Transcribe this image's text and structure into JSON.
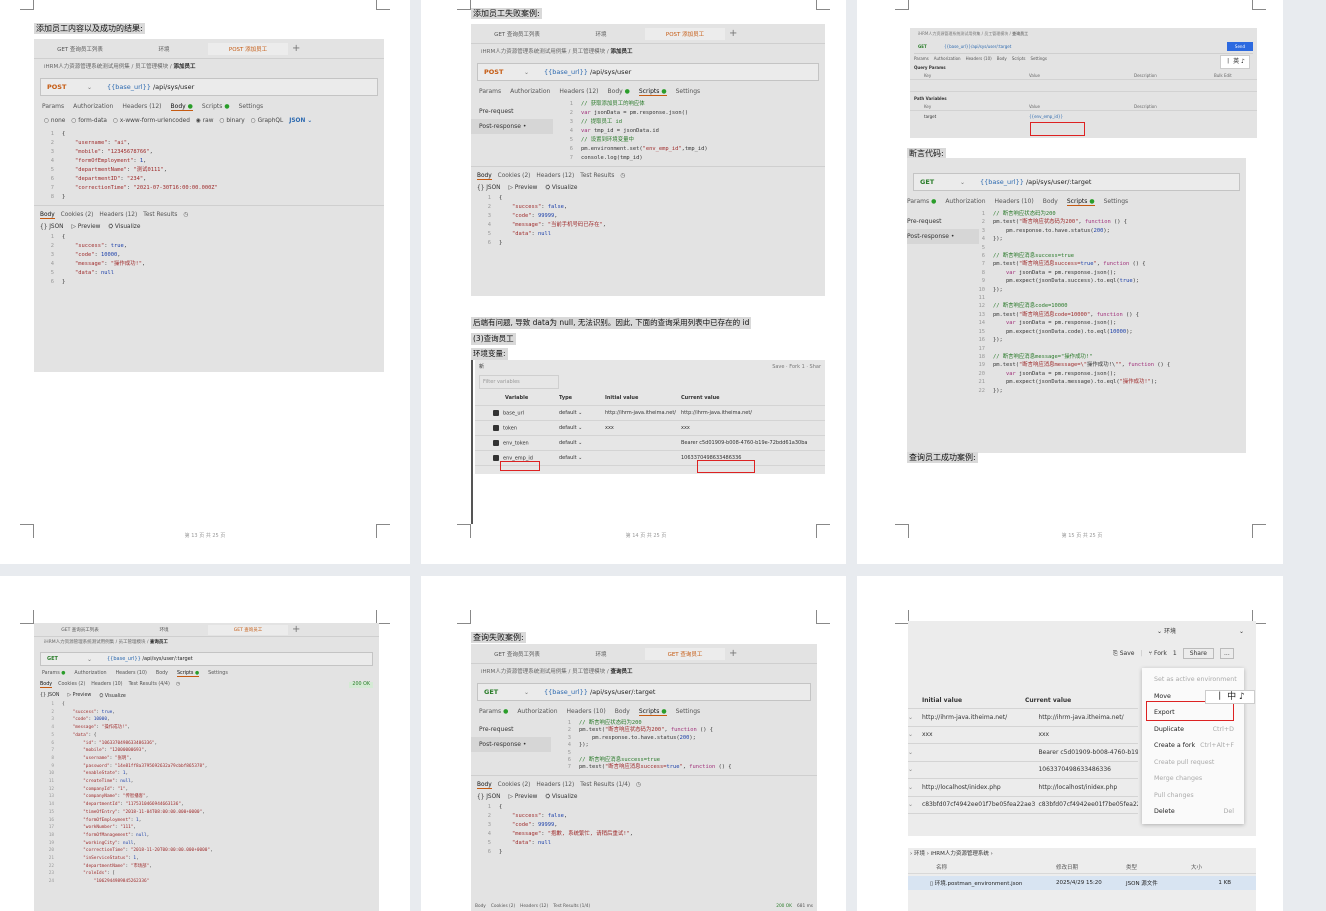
{
  "page_numbers": [
    "第 13 页 共 25 页",
    "第 14 页 共 25 页",
    "第 15 页 共 25 页"
  ],
  "p13": {
    "caption": "添加员工内容以及成功的结果:",
    "tabs": [
      "GET 查询员工列表",
      "环境",
      "POST 添加员工"
    ],
    "crumb": "iHRM人力资源管理系统测试用例集 / 员工管理模块 /",
    "crumb_bold": "添加员工",
    "method": "POST",
    "url_var": "{{base_url}}",
    "url_path": " /api/sys/user",
    "subtabs": [
      "Params",
      "Authorization",
      "Headers (12)",
      "Body",
      "Scripts",
      "Settings"
    ],
    "radios": [
      "none",
      "form-data",
      "x-www-form-urlencoded",
      "raw",
      "binary",
      "GraphQL",
      "JSON"
    ],
    "body_lines": [
      "{",
      "    \"username\": \"ai\",",
      "    \"mobile\": \"12345678766\",",
      "    \"formOfEmployment\": 1,",
      "    \"departmentName\": \"测试0111\",",
      "    \"departmentID\": \"234\",",
      "    \"correctionTime\": \"2021-07-30T16:00:00.000Z\"",
      "}"
    ],
    "resp_tabs": [
      "Body",
      "Cookies (2)",
      "Headers (12)",
      "Test Results"
    ],
    "json_bar": [
      "{} JSON",
      "Preview",
      "Visualize"
    ],
    "resp_lines": [
      "{",
      "    \"success\": true,",
      "    \"code\": 10000,",
      "    \"message\": \"操作成功!\",",
      "    \"data\": null",
      "}"
    ]
  },
  "p14": {
    "caption": "添加员工失败案例:",
    "tabs": [
      "GET 查询员工列表",
      "环境",
      "POST 添加员工"
    ],
    "crumb": "iHRM人力资源管理系统测试用例集 / 员工管理模块 /",
    "crumb_bold": "添加员工",
    "method": "POST",
    "url_var": "{{base_url}}",
    "url_path": " /api/sys/user",
    "subtabs": [
      "Params",
      "Authorization",
      "Headers (12)",
      "Body",
      "Scripts",
      "Settings"
    ],
    "side": [
      "Pre-request",
      "Post-response"
    ],
    "script_lines": [
      "// 获取添加员工的响应体",
      "var jsonData = pm.response.json()",
      "// 提取员工 id",
      "var tmp_id = jsonData.id",
      "// 设置到环境变量中",
      "pm.environment.set(\"env_emp_id\",tmp_id)",
      "console.log(tmp_id)"
    ],
    "resp_tabs": [
      "Body",
      "Cookies (2)",
      "Headers (12)",
      "Test Results"
    ],
    "json_bar": [
      "{} JSON",
      "Preview",
      "Visualize"
    ],
    "resp_lines": [
      "{",
      "    \"success\": false,",
      "    \"code\": 99999,",
      "    \"message\": \"当前手机号码已存在\",",
      "    \"data\": null",
      "}"
    ],
    "para1": "后端有问题, 导致 data为 null, 无法识别。因此, 下面的查询采用列表中已存在的 id",
    "para2": "(3)查询员工",
    "para3": "环境变量:",
    "env": {
      "title": "新",
      "top_actions": [
        "Save",
        "Fork",
        "1",
        "Shar"
      ],
      "filter": "Filter variables",
      "headers": [
        "Variable",
        "Type",
        "Initial value",
        "Current value"
      ],
      "rows": [
        [
          "base_url",
          "default",
          "http://ihrm-java.itheima.net/",
          "http://ihrm-java.itheima.net/"
        ],
        [
          "token",
          "default",
          "xxx",
          "xxx"
        ],
        [
          "env_token",
          "default",
          "",
          "Bearer c5d01909-b008-4760-b19e-72bdd61a30ba"
        ],
        [
          "env_emp_id",
          "default",
          "",
          "1063370498633486336"
        ]
      ]
    }
  },
  "p15": {
    "top_crumb": "iHRM人力资源管理系统测试用例集 / 员工管理模块 /",
    "top_crumb_bold": "查询员工",
    "top_method": "GET",
    "top_url": "{{base_url}}/api/sys/user/:target",
    "top_subtabs": [
      "Params",
      "Authorization",
      "Headers (10)",
      "Body",
      "Scripts",
      "Settings"
    ],
    "top_query": "Query Params",
    "top_cols": [
      "Key",
      "Value",
      "Description",
      "Bulk Edit"
    ],
    "top_path": "Path Variables",
    "top_target": "target",
    "top_target_val": "{{env_emp_id}}",
    "send": "Send",
    "caption": "断言代码:",
    "method": "GET",
    "url_var": "{{base_url}}",
    "url_path": " /api/sys/user/:target",
    "subtabs": [
      "Params",
      "Authorization",
      "Headers (10)",
      "Body",
      "Scripts",
      "Settings"
    ],
    "side": [
      "Pre-request",
      "Post-response"
    ],
    "script_lines": [
      "// 断言响应状态码为200",
      "pm.test(\"断言响应状态码为200\", function () {",
      "    pm.response.to.have.status(200);",
      "});",
      "",
      "// 断言响应消息success=true",
      "pm.test(\"断言响应消息success=true\", function () {",
      "    var jsonData = pm.response.json();",
      "    pm.expect(jsonData.success).to.eql(true);",
      "});",
      "",
      "// 断言响应消息code=10000",
      "pm.test(\"断言响应消息code=10000\", function () {",
      "    var jsonData = pm.response.json();",
      "    pm.expect(jsonData.code).to.eql(10000);",
      "});",
      "",
      "// 断言响应消息message=\"操作成功!\"",
      "pm.test(\"断言响应消息message=\\\"操作成功!\\\"\", function () {",
      "    var jsonData = pm.response.json();",
      "    pm.expect(jsonData.message).to.eql(\"操作成功!\");",
      "});"
    ],
    "caption2": "查询员工成功案例:"
  },
  "p16": {
    "tabs": [
      "GET 查询员工列表",
      "环境",
      "GET 查询员工"
    ],
    "crumb": "iHRM人力资源管理系统测试用例集 / 员工管理模块 /",
    "crumb_bold": "查询员工",
    "method": "GET",
    "url_var": "{{base_url}}",
    "url_path": " /api/sys/user/:target",
    "subtabs": [
      "Params",
      "Authorization",
      "Headers (10)",
      "Body",
      "Scripts",
      "Settings"
    ],
    "resp_tabs": [
      "Body",
      "Cookies (2)",
      "Headers (10)",
      "Test Results (4/4)"
    ],
    "status": "200 OK",
    "json_bar": [
      "{} JSON",
      "Preview",
      "Visualize"
    ],
    "resp_lines": [
      "{",
      "    \"success\": true,",
      "    \"code\": 10000,",
      "    \"message\": \"操作成功!\",",
      "    \"data\": {",
      "        \"id\": \"1063370498633486336\",",
      "        \"mobile\": \"12000000693\",",
      "        \"username\": \"张明\",",
      "        \"password\": \"14e81ff8a3795692632a79cbbf865378\",",
      "        \"enableState\": 1,",
      "        \"createTime\": null,",
      "        \"companyId\": \"1\",",
      "        \"companyName\": \"传智播客\",",
      "        \"departmentId\": \"1175310466944663136\",",
      "        \"timeOfEntry\": \"2018-11-04T08:00:00.000+0000\",",
      "        \"formOfEmployment\": 1,",
      "        \"workNumber\": \"111\",",
      "        \"formOfManagement\": null,",
      "        \"workingCity\": null,",
      "        \"correctionTime\": \"2018-11-20T00:00:00.000+0000\",",
      "        \"inServiceStatus\": 1,",
      "        \"departmentName\": \"市场部\",",
      "        \"roleIds\": [",
      "            \"1062944989845262336\""
    ]
  },
  "p17": {
    "caption": "查询失败案例:",
    "tabs": [
      "GET 查询员工列表",
      "环境",
      "GET 查询员工"
    ],
    "crumb": "iHRM人力资源管理系统测试用例集 / 员工管理模块 /",
    "crumb_bold": "查询员工",
    "method": "GET",
    "url_var": "{{base_url}}",
    "url_path": " /api/sys/user/:target",
    "subtabs": [
      "Params",
      "Authorization",
      "Headers (10)",
      "Body",
      "Scripts",
      "Settings"
    ],
    "side": [
      "Pre-request",
      "Post-response"
    ],
    "script_lines": [
      "// 断言响应状态码为200",
      "pm.test(\"断言响应状态码为200\", function () {",
      "    pm.response.to.have.status(200);",
      "});",
      "",
      "// 断言响应消息success=true",
      "pm.test(\"断言响应消息success=true\", function () {"
    ],
    "resp_tabs": [
      "Body",
      "Cookies (2)",
      "Headers (12)",
      "Test Results (1/4)"
    ],
    "json_bar": [
      "{} JSON",
      "Preview",
      "Visualize"
    ],
    "resp_lines": [
      "{",
      "    \"success\": false,",
      "    \"code\": 99999,",
      "    \"message\": \"抱歉, 系统繁忙, 请稍后重试!\",",
      "    \"data\": null",
      "}"
    ],
    "bottom": [
      "Body",
      "Cookies (2)",
      "Headers (12)",
      "Test Results (1/4)",
      "200 OK",
      "681 ms"
    ]
  },
  "p18": {
    "env_select": "环境",
    "actions": [
      "Save",
      "Fork",
      "1",
      "Share",
      "..."
    ],
    "headers": [
      "Initial value",
      "Current value"
    ],
    "rows": [
      [
        "http://ihrm-java.itheima.net/",
        "http://ihrm-java.itheima.net/"
      ],
      [
        "xxx",
        "xxx"
      ],
      [
        "",
        "Bearer c5d01909-b008-4760-b19e"
      ],
      [
        "",
        "1063370498633486336"
      ],
      [
        "http://localhost/inidex.php",
        "http://localhost/inidex.php"
      ],
      [
        "c83bfd07cf4942ee01f7be05fea22ae3",
        "c83bfd07cf4942ee01f7be05fea22a"
      ]
    ],
    "menu": [
      [
        "Set as active environment",
        ""
      ],
      [
        "Move",
        ""
      ],
      [
        "Export",
        ""
      ],
      [
        "Duplicate",
        "Ctrl+D"
      ],
      [
        "Create a fork",
        "Ctrl+Alt+F"
      ],
      [
        "Create pull request",
        ""
      ],
      [
        "Merge changes",
        ""
      ],
      [
        "Pull changes",
        ""
      ],
      [
        "Delete",
        "Del"
      ]
    ],
    "menu_disabled": [
      0,
      5,
      6,
      7
    ],
    "ime": [
      "中"
    ],
    "explorer_crumb": "› 环境 › iHRM人力资源管理系统 ›",
    "explorer_cols": [
      "名称",
      "修改日期",
      "类型",
      "大小"
    ],
    "file": [
      "环境.postman_environment.json",
      "2025/4/29 15:20",
      "JSON 源文件",
      "1 KB"
    ]
  },
  "colors": {
    "accent": "#c55a11",
    "redbox": "#dd2222",
    "page_bg": "#e8ebef"
  }
}
